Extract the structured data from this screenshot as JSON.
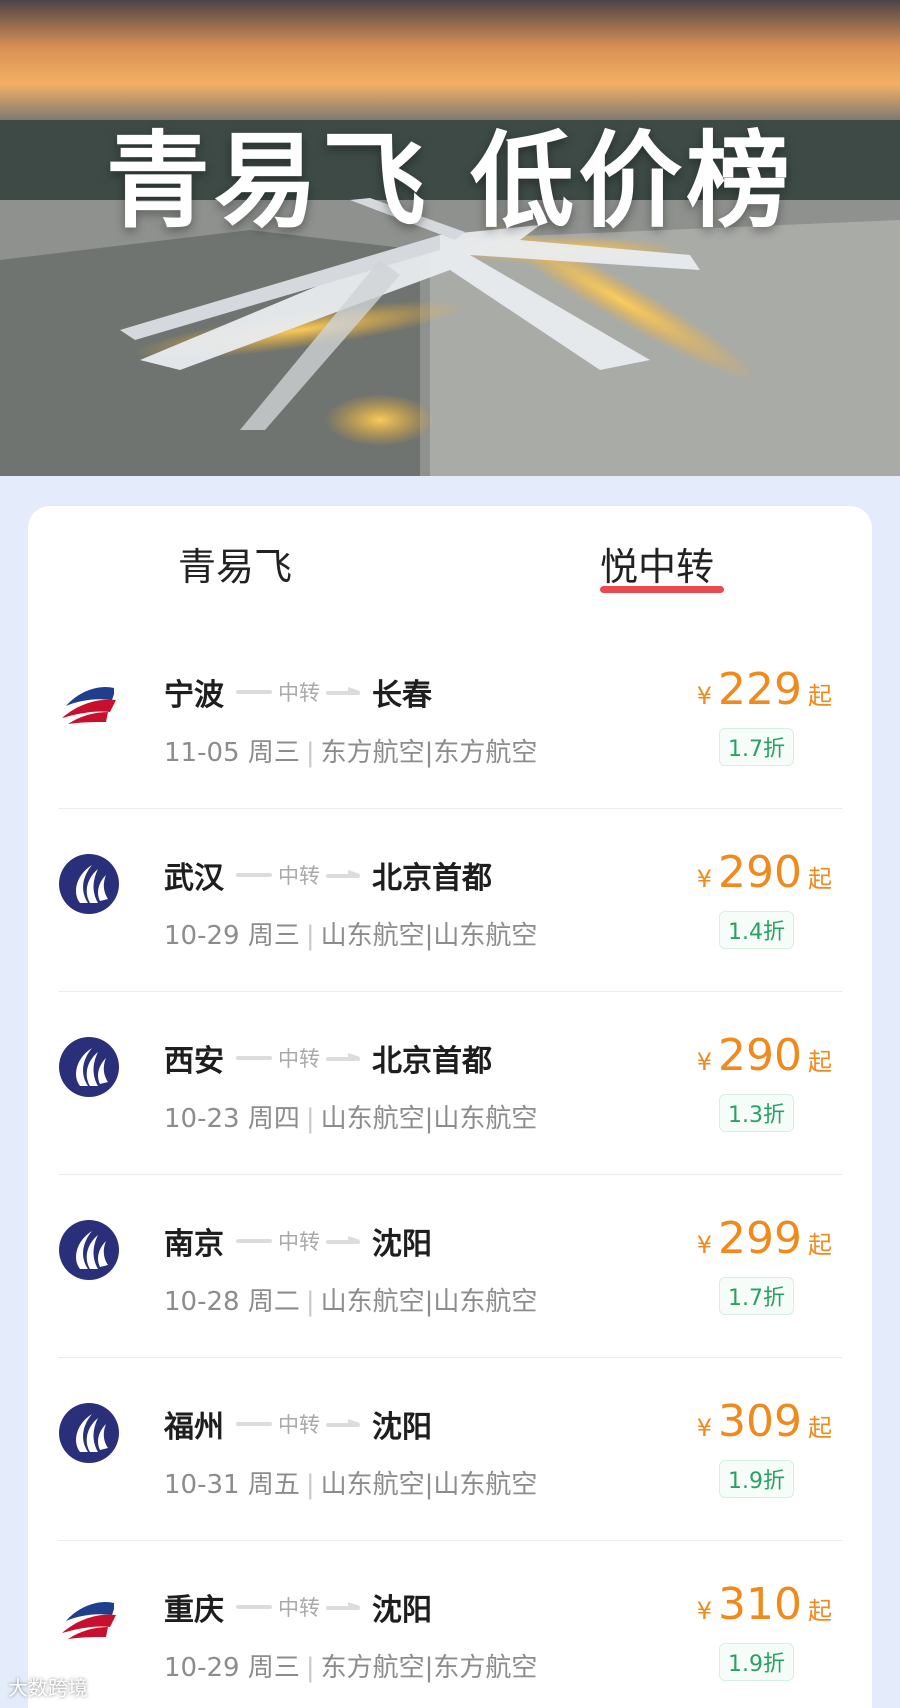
{
  "banner": {
    "title": "青易飞 低价榜"
  },
  "tabs": [
    {
      "label": "青易飞",
      "active": false
    },
    {
      "label": "悦中转",
      "active": true
    }
  ],
  "colors": {
    "accent": "#e84a4f",
    "price": "#f08a1c",
    "discount": "#2aa164"
  },
  "flights": [
    {
      "from": "宁波",
      "via": "中转",
      "to": "长春",
      "date": "11-05 周三",
      "airlines": "东方航空|东方航空",
      "currency": "¥",
      "price": "229",
      "suffix": "起",
      "discount": "1.7折",
      "logo": "china-eastern-logo"
    },
    {
      "from": "武汉",
      "via": "中转",
      "to": "北京首都",
      "date": "10-29 周三",
      "airlines": "山东航空|山东航空",
      "currency": "¥",
      "price": "290",
      "suffix": "起",
      "discount": "1.4折",
      "logo": "shandong-airlines-logo"
    },
    {
      "from": "西安",
      "via": "中转",
      "to": "北京首都",
      "date": "10-23 周四",
      "airlines": "山东航空|山东航空",
      "currency": "¥",
      "price": "290",
      "suffix": "起",
      "discount": "1.3折",
      "logo": "shandong-airlines-logo"
    },
    {
      "from": "南京",
      "via": "中转",
      "to": "沈阳",
      "date": "10-28 周二",
      "airlines": "山东航空|山东航空",
      "currency": "¥",
      "price": "299",
      "suffix": "起",
      "discount": "1.7折",
      "logo": "shandong-airlines-logo"
    },
    {
      "from": "福州",
      "via": "中转",
      "to": "沈阳",
      "date": "10-31 周五",
      "airlines": "山东航空|山东航空",
      "currency": "¥",
      "price": "309",
      "suffix": "起",
      "discount": "1.9折",
      "logo": "shandong-airlines-logo"
    },
    {
      "from": "重庆",
      "via": "中转",
      "to": "沈阳",
      "date": "10-29 周三",
      "airlines": "东方航空|东方航空",
      "currency": "¥",
      "price": "310",
      "suffix": "起",
      "discount": "1.9折",
      "logo": "china-eastern-logo"
    }
  ],
  "watermark": "大数跨境"
}
